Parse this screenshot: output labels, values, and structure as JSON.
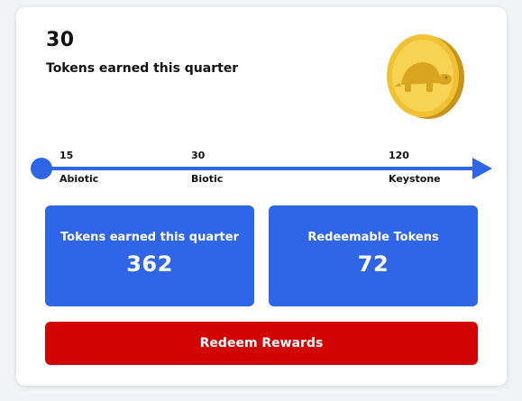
{
  "summary": {
    "tokens_value": "30",
    "tokens_label": "Tokens earned this quarter"
  },
  "icons": {
    "coin": "turtle-coin-icon"
  },
  "timeline": {
    "milestones": [
      {
        "value": "15",
        "name": "Abiotic"
      },
      {
        "value": "30",
        "name": "Biotic"
      },
      {
        "value": "120",
        "name": "Keystone"
      }
    ]
  },
  "stats": {
    "earned": {
      "label": "Tokens earned this quarter",
      "value": "362"
    },
    "redeemable": {
      "label": "Redeemable Tokens",
      "value": "72"
    }
  },
  "actions": {
    "redeem_label": "Redeem Rewards"
  },
  "colors": {
    "accent_blue": "#2f66e8",
    "redeem_red": "#d10303",
    "coin_gold": "#f2c53d"
  }
}
